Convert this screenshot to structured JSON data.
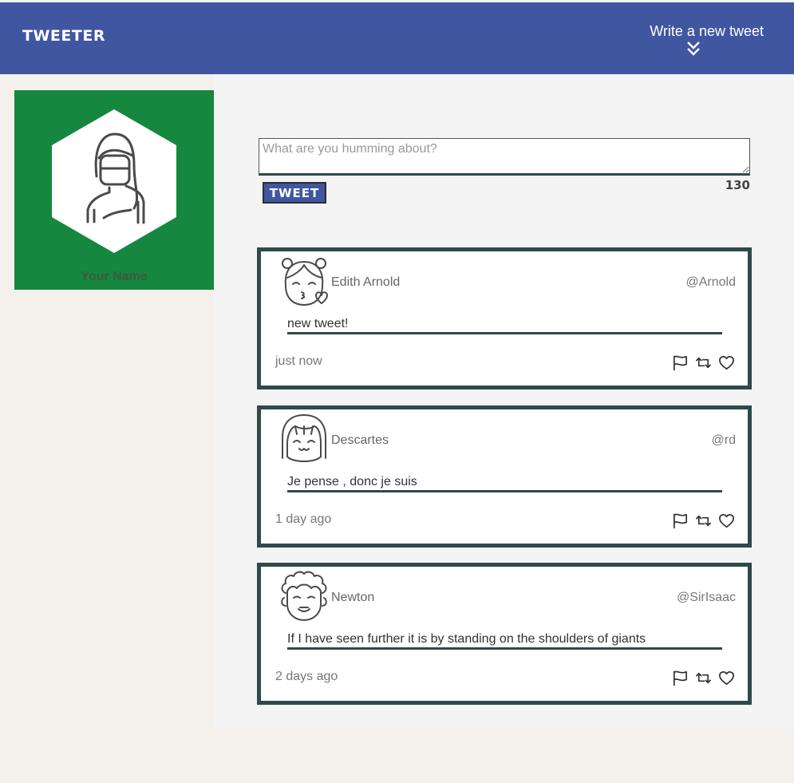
{
  "nav": {
    "brand": "TWEETER",
    "compose_label": "Write a new tweet",
    "compose_icon": "double-chevron-down-icon",
    "background": "#4056a1"
  },
  "profile": {
    "name": "Your Name",
    "avatar_icon": "woman-avatar-icon",
    "background": "#16873e"
  },
  "compose": {
    "placeholder": "What are you humming about?",
    "value": "",
    "button_label": "TWEET",
    "counter": "130"
  },
  "tweets": [
    {
      "name": "Edith Arnold",
      "handle": "@Arnold",
      "text": "new tweet!",
      "time": "just now",
      "avatar_icon": "girl-kiss-avatar-icon"
    },
    {
      "name": "Descartes",
      "handle": "@rd",
      "text": "Je pense , donc je suis",
      "time": "1 day ago",
      "avatar_icon": "girl-bob-avatar-icon"
    },
    {
      "name": "Newton",
      "handle": "@SirIsaac",
      "text": "If I have seen further it is by standing on the shoulders of giants",
      "time": "2 days ago",
      "avatar_icon": "curly-hair-avatar-icon"
    }
  ],
  "actions": [
    "flag-icon",
    "retweet-icon",
    "heart-icon"
  ],
  "colors": {
    "accent": "#4056a1",
    "tweet_border": "#2e4a4a",
    "profile_green": "#16873e"
  }
}
